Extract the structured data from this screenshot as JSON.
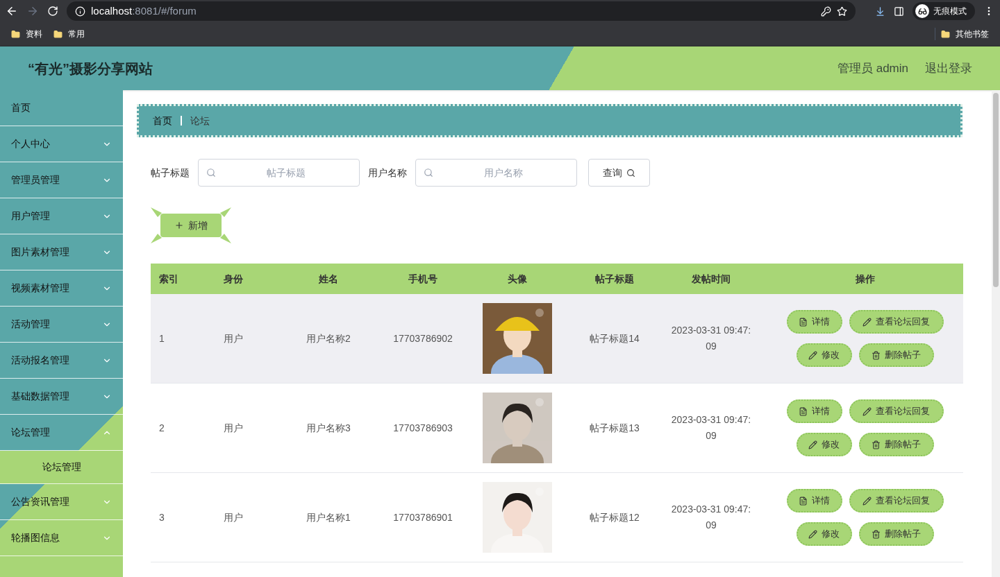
{
  "browser": {
    "url_host": "localhost",
    "url_rest": ":8081/#/forum",
    "profile": "无痕模式",
    "bookmarks": [
      "资料",
      "常用"
    ],
    "other_bookmarks": "其他书签"
  },
  "header": {
    "title": "“有光”摄影分享网站",
    "user": "管理员 admin",
    "logout": "退出登录"
  },
  "sidebar": {
    "items": [
      {
        "label": "首页",
        "kind": "link"
      },
      {
        "label": "个人中心",
        "kind": "menu",
        "expanded": false
      },
      {
        "label": "管理员管理",
        "kind": "menu",
        "expanded": false
      },
      {
        "label": "用户管理",
        "kind": "menu",
        "expanded": false
      },
      {
        "label": "图片素材管理",
        "kind": "menu",
        "expanded": false
      },
      {
        "label": "视频素材管理",
        "kind": "menu",
        "expanded": false
      },
      {
        "label": "活动管理",
        "kind": "menu",
        "expanded": false
      },
      {
        "label": "活动报名管理",
        "kind": "menu",
        "expanded": false
      },
      {
        "label": "基础数据管理",
        "kind": "menu",
        "expanded": false
      },
      {
        "label": "论坛管理",
        "kind": "menu",
        "expanded": true,
        "children": [
          {
            "label": "论坛管理",
            "selected": true
          }
        ]
      },
      {
        "label": "公告资讯管理",
        "kind": "menu",
        "expanded": false
      },
      {
        "label": "轮播图信息",
        "kind": "menu",
        "expanded": false
      }
    ]
  },
  "breadcrumb": [
    "首页",
    "论坛"
  ],
  "search": {
    "fields": [
      {
        "label": "帖子标题",
        "placeholder": "帖子标题"
      },
      {
        "label": "用户名称",
        "placeholder": "用户名称"
      }
    ],
    "button": "查询"
  },
  "add_button": "新增",
  "table": {
    "columns": [
      "索引",
      "身份",
      "姓名",
      "手机号",
      "头像",
      "帖子标题",
      "发帖时间",
      "操作"
    ],
    "rows": [
      {
        "cells": [
          "1",
          "用户",
          "用户名称2",
          "17703786902"
        ],
        "title": "帖子标题14",
        "time": "2023-03-31 09:47:09",
        "hovered": true,
        "actions": [
          "详情",
          "查看论坛回复",
          "修改",
          "删除帖子"
        ]
      },
      {
        "cells": [
          "2",
          "用户",
          "用户名称3",
          "17703786903"
        ],
        "title": "帖子标题13",
        "time": "2023-03-31 09:47:09",
        "hovered": false,
        "actions": [
          "详情",
          "查看论坛回复",
          "修改",
          "删除帖子"
        ]
      },
      {
        "cells": [
          "3",
          "用户",
          "用户名称1",
          "17703786901"
        ],
        "title": "帖子标题12",
        "time": "2023-03-31 09:47:09",
        "hovered": false,
        "actions": [
          "详情",
          "查看论坛回复",
          "修改",
          "删除帖子"
        ]
      }
    ]
  }
}
